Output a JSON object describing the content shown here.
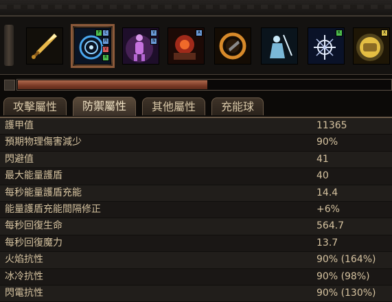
{
  "skill_bar": {
    "gems": [
      {
        "icon": "golden-sword-icon",
        "color": "#d8a53a"
      },
      {
        "icon": "blue-vortex-icon",
        "color": "#3c8ee0",
        "selected": true,
        "links": [
          "P",
          "C",
          "M",
          "V",
          "R"
        ]
      },
      {
        "icon": "glowing-figure-icon",
        "color": "#c05ad8",
        "links": [
          "V",
          "N"
        ]
      },
      {
        "icon": "fire-warrior-icon",
        "color": "#d84a2a",
        "links": [
          "A"
        ]
      },
      {
        "icon": "fire-ring-icon",
        "color": "#c87a2a"
      },
      {
        "icon": "frost-figure-icon",
        "color": "#7ab8d8"
      },
      {
        "icon": "white-sigil-icon",
        "color": "#2a4a8a",
        "links": [
          "K"
        ]
      },
      {
        "icon": "golden-fist-icon",
        "color": "#e0b83a",
        "links": [
          "X"
        ]
      }
    ]
  },
  "progress": {
    "fraction": 0.51
  },
  "tabs": [
    {
      "label": "攻擊屬性",
      "active": false
    },
    {
      "label": "防禦屬性",
      "active": true
    },
    {
      "label": "其他屬性",
      "active": false
    },
    {
      "label": "充能球",
      "active": false
    }
  ],
  "stats": [
    {
      "label": "護甲值",
      "value": "11365"
    },
    {
      "label": "預期物理傷害減少",
      "value": "90%"
    },
    {
      "label": "閃避值",
      "value": "41"
    },
    {
      "label": "最大能量護盾",
      "value": "40"
    },
    {
      "label": "每秒能量護盾充能",
      "value": "14.4"
    },
    {
      "label": "能量護盾充能間隔修正",
      "value": "+6%"
    },
    {
      "label": "每秒回復生命",
      "value": "564.7"
    },
    {
      "label": "每秒回復魔力",
      "value": "13.7"
    },
    {
      "label": "火焰抗性",
      "value": "90% (164%)"
    },
    {
      "label": "冰冷抗性",
      "value": "90% (98%)"
    },
    {
      "label": "閃電抗性",
      "value": "90% (130%)"
    }
  ]
}
